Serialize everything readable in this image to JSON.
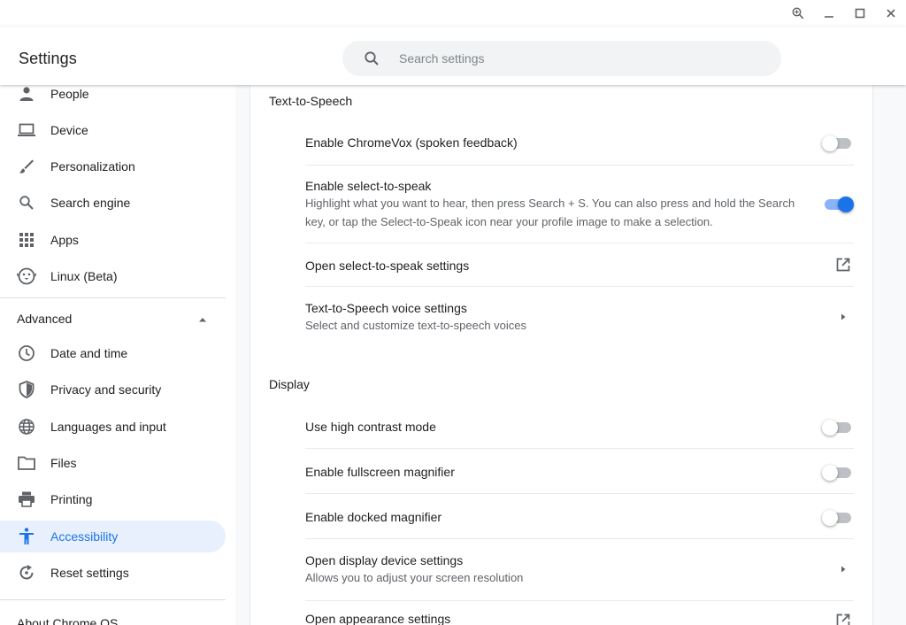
{
  "window": {
    "controls": [
      "zoom-icon",
      "minimize-icon",
      "maximize-icon",
      "close-icon"
    ]
  },
  "header": {
    "title": "Settings",
    "search_placeholder": "Search settings"
  },
  "sidebar": {
    "items": [
      {
        "label": "People",
        "icon": "person-icon"
      },
      {
        "label": "Device",
        "icon": "laptop-icon"
      },
      {
        "label": "Personalization",
        "icon": "brush-icon"
      },
      {
        "label": "Search engine",
        "icon": "search-icon"
      },
      {
        "label": "Apps",
        "icon": "apps-grid-icon"
      },
      {
        "label": "Linux (Beta)",
        "icon": "linux-penguin-icon"
      }
    ],
    "advanced_label": "Advanced",
    "advanced_items": [
      {
        "label": "Date and time",
        "icon": "clock-icon"
      },
      {
        "label": "Privacy and security",
        "icon": "shield-icon"
      },
      {
        "label": "Languages and input",
        "icon": "globe-icon"
      },
      {
        "label": "Files",
        "icon": "folder-icon"
      },
      {
        "label": "Printing",
        "icon": "printer-icon"
      },
      {
        "label": "Accessibility",
        "icon": "accessibility-icon",
        "active": true
      },
      {
        "label": "Reset settings",
        "icon": "reset-icon"
      }
    ],
    "about_label": "About Chrome OS"
  },
  "main": {
    "tts": {
      "title": "Text-to-Speech",
      "chromevox": {
        "label": "Enable ChromeVox (spoken feedback)",
        "enabled": false
      },
      "select_to_speak": {
        "label": "Enable select-to-speak",
        "description_line1": "Highlight what you want to hear, then press Search + S. You can also press and hold the Search",
        "description_line2": "key, or tap the Select-to-Speak icon near your profile image to make a selection.",
        "enabled": true
      },
      "open_sts_settings": {
        "label": "Open select-to-speak settings"
      },
      "voice_settings": {
        "label": "Text-to-Speech voice settings",
        "description": "Select and customize text-to-speech voices"
      }
    },
    "display": {
      "title": "Display",
      "high_contrast": {
        "label": "Use high contrast mode",
        "enabled": false
      },
      "fullscreen_magnifier": {
        "label": "Enable fullscreen magnifier",
        "enabled": false
      },
      "docked_magnifier": {
        "label": "Enable docked magnifier",
        "enabled": false
      },
      "display_device": {
        "label": "Open display device settings",
        "description": "Allows you to adjust your screen resolution"
      },
      "appearance": {
        "label": "Open appearance settings"
      }
    }
  },
  "colors": {
    "accent": "#1a73e8",
    "active_bg": "#e8f0fe",
    "toggle_on_track": "#8ab4f8",
    "toggle_off_track": "#bdc1c6"
  }
}
